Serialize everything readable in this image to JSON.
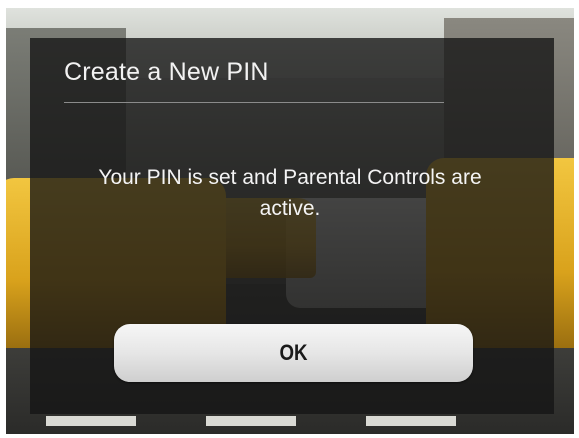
{
  "dialog": {
    "title": "Create a New PIN",
    "message": "Your PIN is set and Parental Controls are active.",
    "ok_label": "OK"
  },
  "colors": {
    "overlay": "#141414",
    "title_text": "#f2f2f2",
    "button_bg": "#e6e6e6",
    "button_text": "#1a1a1a"
  }
}
